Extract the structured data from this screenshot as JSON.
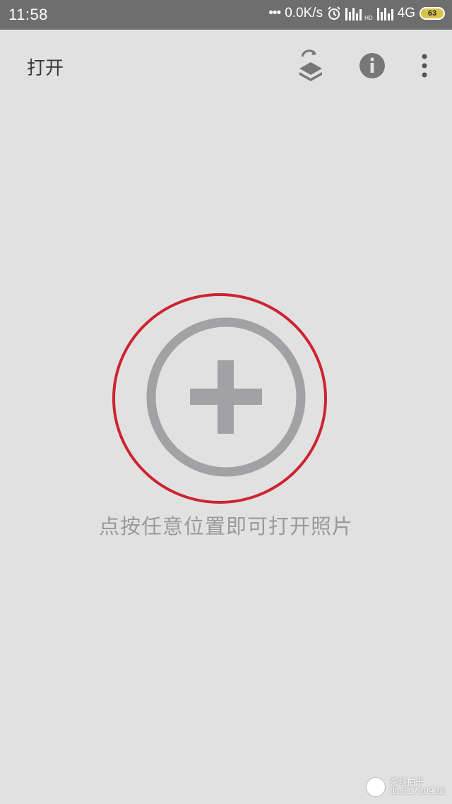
{
  "status_bar": {
    "time": "11:58",
    "net_speed": "0.0K/s",
    "network": "4G",
    "hd": "HD",
    "battery": "63"
  },
  "toolbar": {
    "title": "打开",
    "icons": [
      "layers-refresh-icon",
      "info-icon",
      "more-vert-icon"
    ]
  },
  "main": {
    "hint": "点按任意位置即可打开照片",
    "icon": "add-circle-icon",
    "highlight_color": "#cc2430",
    "icon_color": "#a2a1a4"
  },
  "watermark": {
    "line1": "茶场拍干",
    "line2": "ID:61730938"
  }
}
